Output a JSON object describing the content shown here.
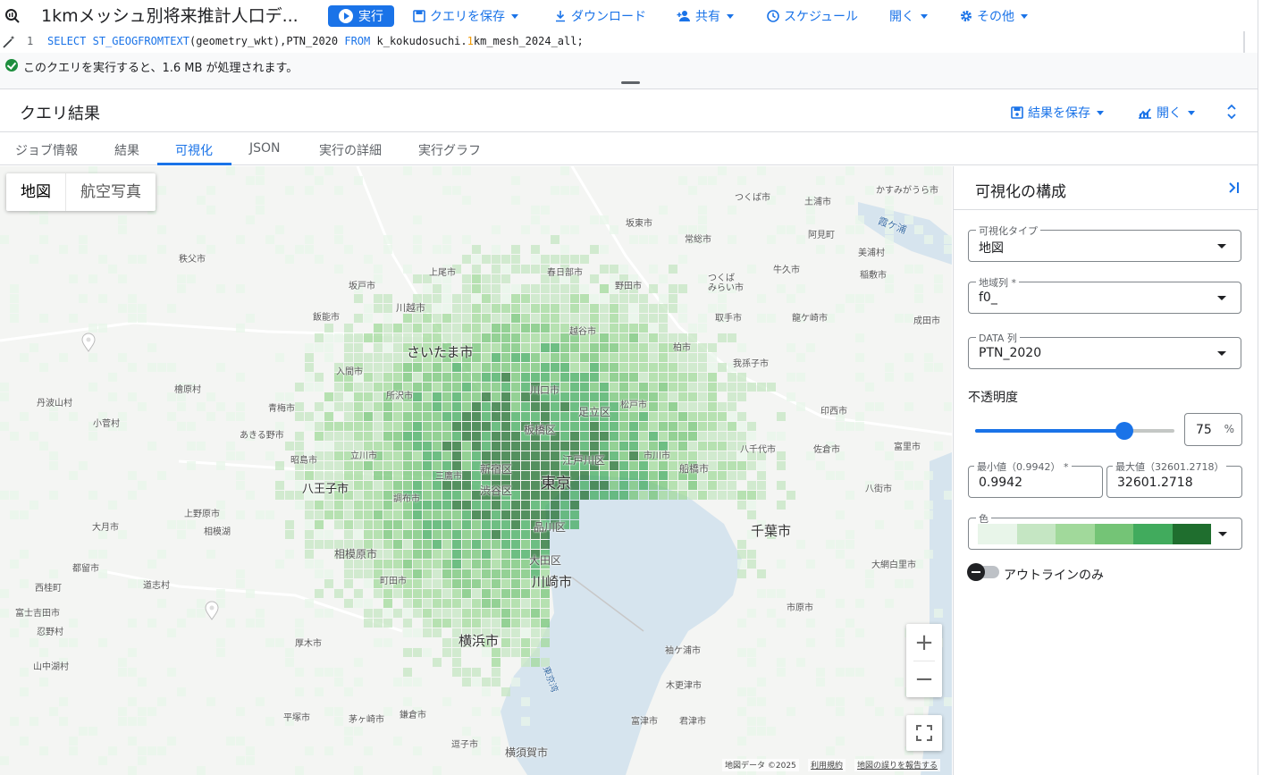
{
  "toolbar": {
    "title": "1kmメッシュ別将来推計人口デ...",
    "run": "実行",
    "save_query": "クエリを保存",
    "download": "ダウンロード",
    "share": "共有",
    "schedule": "スケジュール",
    "open": "開く",
    "more": "その他"
  },
  "editor": {
    "line_number": "1",
    "code": {
      "kw_select": "SELECT",
      "fn": "ST_GEOGFROMTEXT",
      "args": "(geometry_wkt),PTN_2020 ",
      "kw_from": "FROM",
      "table_pre": " k_kokudosuchi.",
      "table_num": "1",
      "table_post": "km_mesh_2024_all;"
    }
  },
  "validator": {
    "message": "このクエリを実行すると、1.6 MB が処理されます。"
  },
  "results": {
    "title": "クエリ結果",
    "save_results": "結果を保存",
    "open": "開く"
  },
  "tabs": [
    {
      "label": "ジョブ情報",
      "active": false
    },
    {
      "label": "結果",
      "active": false
    },
    {
      "label": "可視化",
      "active": true
    },
    {
      "label": "JSON",
      "active": false
    },
    {
      "label": "実行の詳細",
      "active": false
    },
    {
      "label": "実行グラフ",
      "active": false
    }
  ],
  "map": {
    "type_map": "地図",
    "type_satellite": "航空写真",
    "zoom_in": "+",
    "zoom_out": "−",
    "attribution": "地図データ ©2025",
    "terms": "利用規約",
    "report": "地図の誤りを報告する",
    "labels": {
      "saitama": "さいたま市",
      "tokyo": "東京",
      "kawasaki": "川崎市",
      "yokohama": "横浜市",
      "chiba": "千葉市",
      "hachioji": "八王子市",
      "sagamihara": "相模原市",
      "shinjuku": "新宿区",
      "shibuya": "渋谷区",
      "itabashi": "板橋区",
      "adachi": "足立区",
      "edogawa": "江戸川区",
      "shinagawa": "品川区",
      "ota": "大田区",
      "kawaguchi": "川口市",
      "kawagoe": "川越市",
      "koshigaya": "越谷市",
      "kashiwa": "柏市",
      "matsudo": "松戸市",
      "funabashi": "船橋市",
      "ichikawa": "市川市",
      "yokosuka": "横須賀市",
      "tsukuba": "つくば市",
      "tsuchiura": "土浦市",
      "kasumigaura": "かすみがうら市",
      "kasumigaura_lake": "霞ケ浦",
      "bando": "坂東市",
      "joso": "常総市",
      "ami": "阿見町",
      "miho": "美浦村",
      "inashiki": "稲敷市",
      "ushiku": "牛久市",
      "tsukubamirai_1": "つくば",
      "tsukubamirai_2": "みらい市",
      "toride": "取手市",
      "ryugasaki": "龍ケ崎市",
      "tamba": "丹波山村",
      "kosuge": "小菅村",
      "otsuki": "大月市",
      "tsuru": "都留市",
      "nishikatsura": "西桂町",
      "fujiyoshida": "富士吉田市",
      "oshino": "忍野村",
      "yamanakako": "山中湖村",
      "doshi": "道志村",
      "hinohara": "檜原村",
      "uenohara": "上野原市",
      "tokyo_bay": "東京湾",
      "ageo": "上尾市",
      "kasukabe": "春日部市",
      "sakado": "坂戸市",
      "iruma": "入間市",
      "tokorozawa": "所沢市",
      "akishima": "昭島市",
      "tachikawa": "立川市",
      "chofu": "調布市",
      "mitaka": "三鷹市",
      "machida": "町田市",
      "atsugi": "厚木市",
      "chigasaki": "茅ヶ崎市",
      "hiratsuka": "平塚市",
      "kamakura": "鎌倉市",
      "zushi": "逗子市",
      "yachiyo": "八千代市",
      "sakura": "佐倉市",
      "ichihara": "市原市",
      "kisarazu": "木更津市",
      "sodegaura": "袖ケ浦市",
      "tomisato": "富里市",
      "yachimata": "八街市",
      "oamishirasato": "大網白里市",
      "futtsu": "富津市",
      "kimitsu": "君津市",
      "noda": "野田市",
      "abiko": "我孫子市",
      "inzai": "印西市",
      "narita": "成田市",
      "hanno": "飯能市",
      "chichibu": "秩父市",
      "ome": "青梅市",
      "akiruno": "あきる野市",
      "sagamiko": "相模湖"
    }
  },
  "panel": {
    "title": "可視化の構成",
    "viz_type_label": "可視化タイプ",
    "viz_type_value": "地図",
    "geo_col_label": "地域列 *",
    "geo_col_value": "f0_",
    "data_col_label": "DATA 列",
    "data_col_value": "PTN_2020",
    "opacity_label": "不透明度",
    "opacity_value": "75",
    "opacity_unit": "%",
    "opacity_fraction": 0.75,
    "min_label": "最小値（0.9942） *",
    "min_value": "0.9942",
    "max_label": "最大値（32601.2718）",
    "max_value": "32601.2718",
    "color_label": "色",
    "color_steps": [
      "#e8f5e9",
      "#c5e6c3",
      "#a1d99b",
      "#74c476",
      "#41ab5d",
      "#1f6e2e"
    ],
    "outline_only_label": "アウトラインのみ",
    "outline_only": false
  },
  "colors": {
    "accent": "#1a73e8",
    "success": "#1e8e3e"
  }
}
